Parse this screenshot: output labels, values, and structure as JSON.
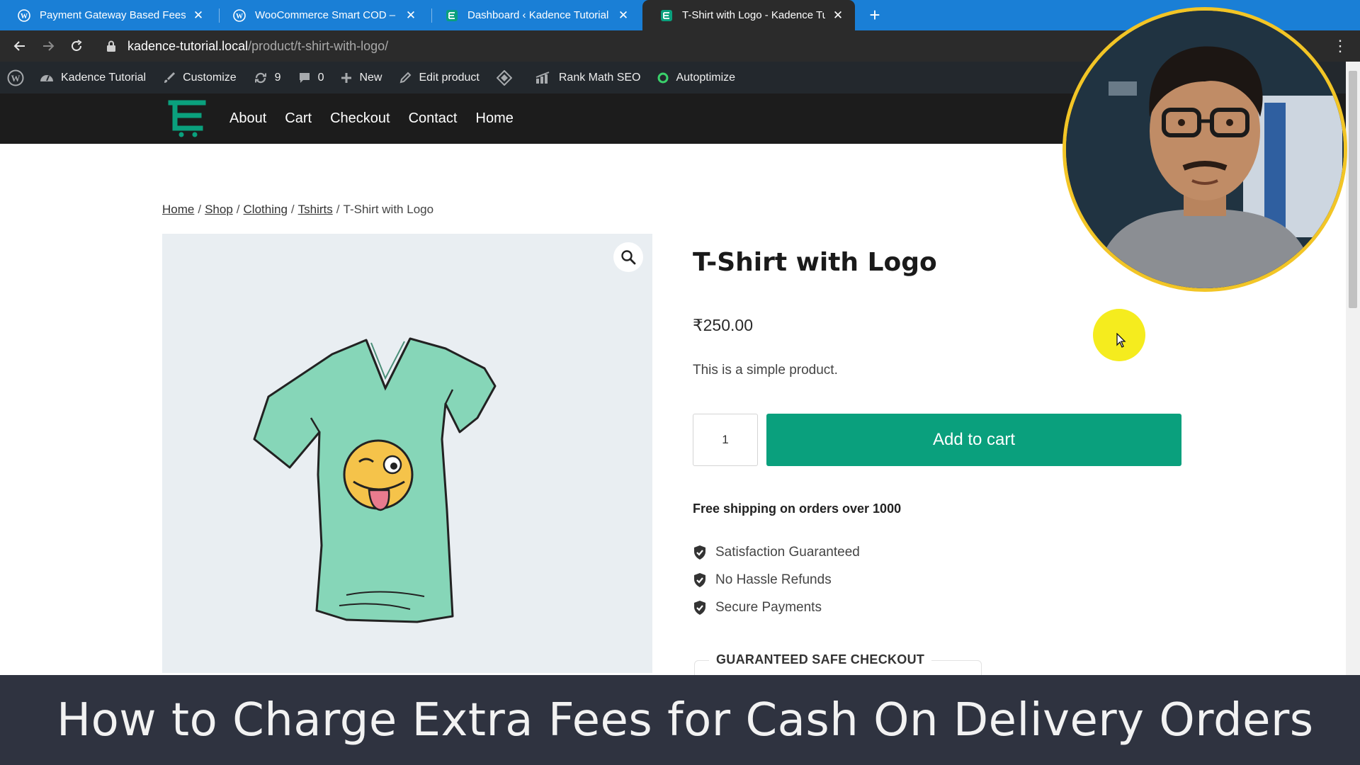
{
  "browser": {
    "tabs": [
      {
        "title": "Payment Gateway Based Fees and",
        "favicon": "wordpress-icon",
        "active": false
      },
      {
        "title": "WooCommerce Smart COD – Wo",
        "favicon": "wordpress-icon",
        "active": false
      },
      {
        "title": "Dashboard ‹ Kadence Tutorial —",
        "favicon": "kadence-icon",
        "active": false
      },
      {
        "title": "T-Shirt with Logo - Kadence Tuto",
        "favicon": "kadence-icon",
        "active": true
      }
    ],
    "close_glyph": "✕",
    "new_tab_glyph": "+",
    "url_host": "kadence-tutorial.local",
    "url_path": "/product/t-shirt-with-logo/",
    "colors": {
      "tabbar": "#1a7fd6",
      "toolbar": "#2b2b2b"
    }
  },
  "admin_bar": {
    "site_name": "Kadence Tutorial",
    "customize": "Customize",
    "updates_count": "9",
    "comments_count": "0",
    "new": "New",
    "edit_product": "Edit product",
    "rank_math": "Rank Math SEO",
    "autoptimize": "Autoptimize"
  },
  "site": {
    "nav": [
      "About",
      "Cart",
      "Checkout",
      "Contact",
      "Home"
    ],
    "accent": "#0aa07d"
  },
  "breadcrumb": {
    "links": [
      "Home",
      "Shop",
      "Clothing",
      "Tshirts"
    ],
    "current": "T-Shirt with Logo",
    "separator": "/"
  },
  "product": {
    "title": "T-Shirt with Logo",
    "price": "₹250.00",
    "short_description": "This is a simple product.",
    "quantity": "1",
    "add_to_cart": "Add to cart",
    "shipping_note": "Free shipping on orders over 1000",
    "features": [
      "Satisfaction Guaranteed",
      "No Hassle Refunds",
      "Secure Payments"
    ],
    "safe_checkout": "GUARANTEED SAFE CHECKOUT"
  },
  "video": {
    "title": "How to Charge Extra Fees for Cash On Delivery Orders"
  }
}
